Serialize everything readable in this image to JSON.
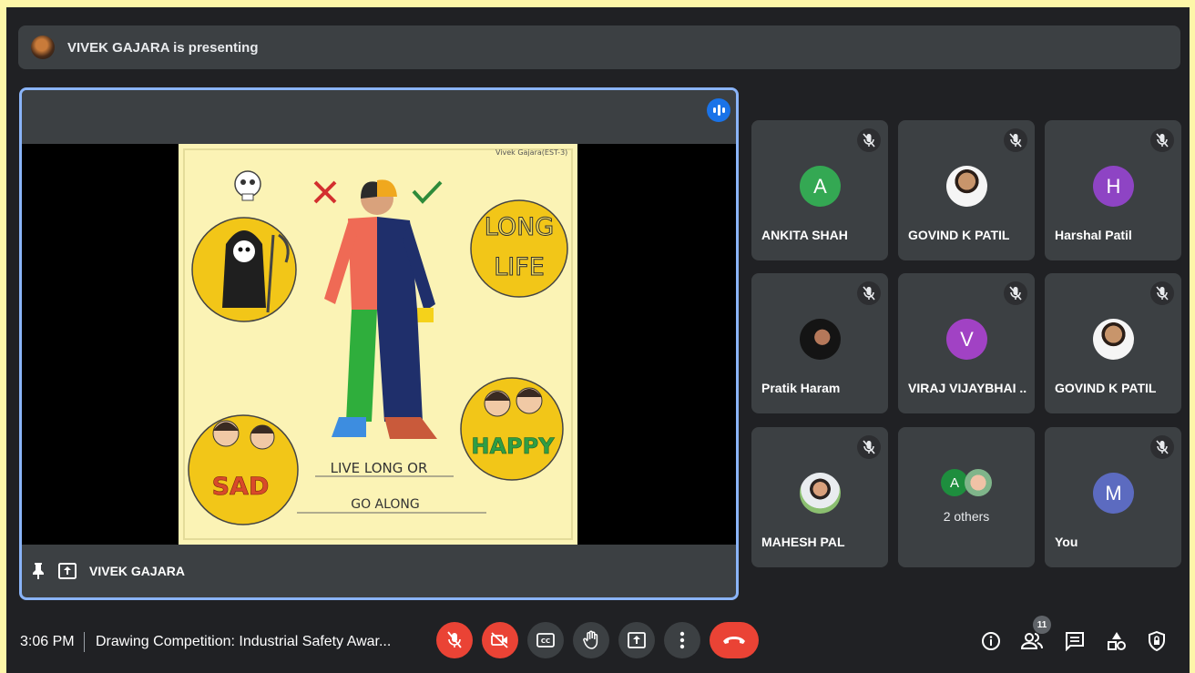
{
  "presenting": {
    "text": "VIVEK GAJARA is presenting"
  },
  "main": {
    "presenter_name": "VIVEK GAJARA",
    "drawing": {
      "signature": "Vivek Gajara(EST-3)",
      "long_word1": "LONG",
      "long_word2": "LIFE",
      "happy": "HAPPY",
      "sad": "SAD",
      "slogan_line1": "LIVE LONG OR",
      "slogan_line2": "GO ALONG"
    }
  },
  "participants": [
    {
      "name": "ANKITA SHAH",
      "initial": "A",
      "color": "#34a853"
    },
    {
      "name": "GOVIND K PATIL",
      "initial": "",
      "color": ""
    },
    {
      "name": "Harshal Patil",
      "initial": "H",
      "color": "#8e44c4"
    },
    {
      "name": "Pratik Haram",
      "initial": "",
      "color": ""
    },
    {
      "name": "VIRAJ VIJAYBHAI ...",
      "initial": "V",
      "color": "#a142c4"
    },
    {
      "name": "GOVIND K PATIL",
      "initial": "",
      "color": ""
    },
    {
      "name": "MAHESH PAL",
      "initial": "",
      "color": ""
    },
    {
      "name": "2 others",
      "initial": "A",
      "color": "#1e8e3e"
    },
    {
      "name": "You",
      "initial": "M",
      "color": "#5c6bc0"
    }
  ],
  "footer": {
    "time": "3:06 PM",
    "meeting_title": "Drawing Competition: Industrial Safety Awar...",
    "people_count": "11"
  },
  "icons": {
    "mic_off": "mic-off-icon",
    "cam_off": "camera-off-icon",
    "captions": "closed-captions-icon",
    "hand": "raise-hand-icon",
    "present": "present-screen-icon",
    "more": "more-vert-icon",
    "hangup": "call-end-icon",
    "info": "info-icon",
    "people": "people-icon",
    "chat": "chat-icon",
    "activities": "activities-icon",
    "host": "host-controls-icon"
  }
}
